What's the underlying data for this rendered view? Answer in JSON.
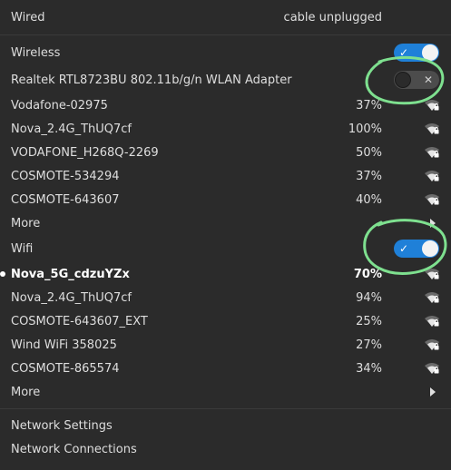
{
  "wired": {
    "label": "Wired",
    "status": "cable unplugged"
  },
  "wireless": {
    "label": "Wireless",
    "enabled": true,
    "toggle_mark": "✓"
  },
  "adapter": {
    "label": "Realtek RTL8723BU 802.11b/g/n WLAN Adapter",
    "enabled": false,
    "toggle_mark": "✕",
    "networks": [
      {
        "name": "Vodafone-02975",
        "strength": "37%",
        "bold": false
      },
      {
        "name": "Nova_2.4G_ThUQ7cf",
        "strength": "100%",
        "bold": false
      },
      {
        "name": "VODAFONE_H268Q-2269",
        "strength": "50%",
        "bold": false
      },
      {
        "name": "COSMOTE-534294",
        "strength": "37%",
        "bold": false
      },
      {
        "name": "COSMOTE-643607",
        "strength": "40%",
        "bold": false
      }
    ],
    "more_label": "More"
  },
  "wifi": {
    "label": "Wifi",
    "enabled": true,
    "toggle_mark": "✓",
    "networks": [
      {
        "name": "Nova_5G_cdzuYZx",
        "strength": "70%",
        "bold": true,
        "connected": true
      },
      {
        "name": "Nova_2.4G_ThUQ7cf",
        "strength": "94%",
        "bold": false
      },
      {
        "name": "COSMOTE-643607_EXT",
        "strength": "25%",
        "bold": false
      },
      {
        "name": "Wind WiFi 358025",
        "strength": "27%",
        "bold": false
      },
      {
        "name": "COSMOTE-865574",
        "strength": "34%",
        "bold": false
      }
    ],
    "more_label": "More"
  },
  "footer": {
    "network_settings": "Network Settings",
    "network_connections": "Network Connections"
  },
  "colors": {
    "background": "#2b2b2b",
    "accent": "#1f80d8",
    "annotation": "#7ee08f"
  },
  "icons": {
    "network": "wifi-signal-locked-icon",
    "more": "chevron-right-icon"
  }
}
